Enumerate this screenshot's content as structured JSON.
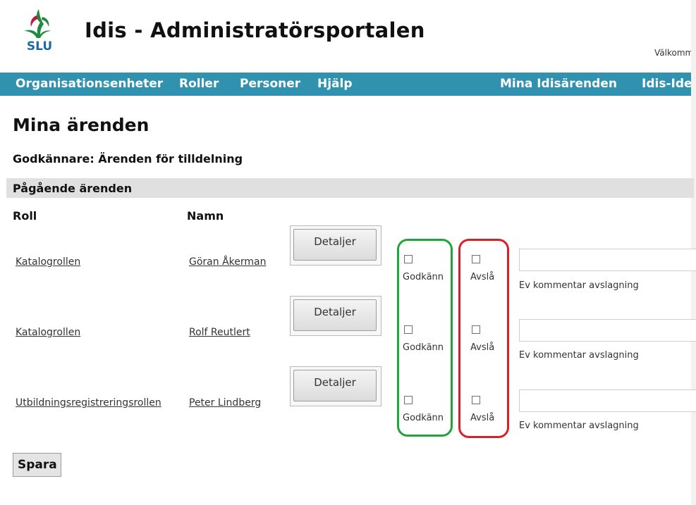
{
  "header": {
    "logo_text": "SLU",
    "title": "Idis - Administratörsportalen",
    "welcome": "Välkommen"
  },
  "nav": {
    "items": [
      "Organisationsenheter",
      "Roller",
      "Personer",
      "Hjälp",
      "Mina Idisärenden",
      "Idis-Ide"
    ]
  },
  "page": {
    "title": "Mina ärenden",
    "subheading": "Godkännare: Ärenden för tilldelning",
    "section_title": "Pågående ärenden",
    "columns": {
      "role": "Roll",
      "name": "Namn"
    }
  },
  "rows": [
    {
      "role": "Katalogrollen",
      "name": "Göran Åkerman",
      "details": "Detaljer",
      "approve": "Godkänn",
      "reject": "Avslå",
      "comment_value": "",
      "comment_help": "Ev kommentar avslagning"
    },
    {
      "role": "Katalogrollen",
      "name": "Rolf Reutlert",
      "details": "Detaljer",
      "approve": "Godkänn",
      "reject": "Avslå",
      "comment_value": "",
      "comment_help": "Ev kommentar avslagning"
    },
    {
      "role": "Utbildningsregistreringsrollen",
      "name": "Peter Lindberg",
      "details": "Detaljer",
      "approve": "Godkänn",
      "reject": "Avslå",
      "comment_value": "",
      "comment_help": "Ev kommentar avslagning"
    }
  ],
  "actions": {
    "save_label": "Spara"
  },
  "colors": {
    "nav_bg": "#3192b0",
    "approve_highlight": "#21a43c",
    "reject_highlight": "#d82127",
    "logo_green": "#1e8a3e",
    "logo_red": "#b51e3c",
    "logo_blue": "#1b6aa5"
  },
  "icons": {
    "logo": "slu-logo-icon"
  }
}
